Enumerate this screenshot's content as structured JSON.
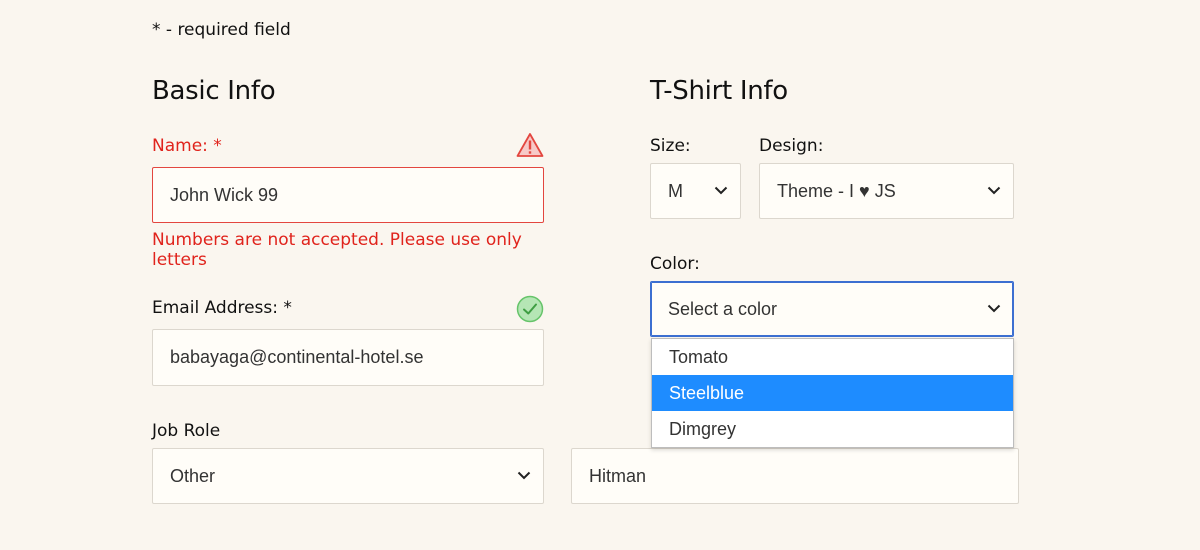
{
  "required_note": "* - required field",
  "basic": {
    "heading": "Basic Info",
    "name": {
      "label": "Name:",
      "required_mark": "*",
      "value": "John Wick 99",
      "error": "Numbers are not accepted. Please use only letters",
      "status_icon": "warning-icon"
    },
    "email": {
      "label": "Email Address:",
      "required_mark": "*",
      "value": "babayaga@continental-hotel.se",
      "status_icon": "check-circle-icon"
    },
    "job_role": {
      "label": "Job Role",
      "selected": "Other",
      "other_value": "Hitman"
    }
  },
  "tshirt": {
    "heading": "T-Shirt Info",
    "size": {
      "label": "Size:",
      "selected": "M"
    },
    "design": {
      "label": "Design:",
      "selected": "Theme - I ♥ JS"
    },
    "color": {
      "label": "Color:",
      "selected": "Select a color",
      "options": [
        "Tomato",
        "Steelblue",
        "Dimgrey"
      ],
      "highlighted": "Steelblue"
    }
  },
  "colors": {
    "error": "#e0231c",
    "focus": "#3c6fd1",
    "highlight": "#1e8cff",
    "valid": "#66c46a",
    "background": "#faf6ef"
  }
}
